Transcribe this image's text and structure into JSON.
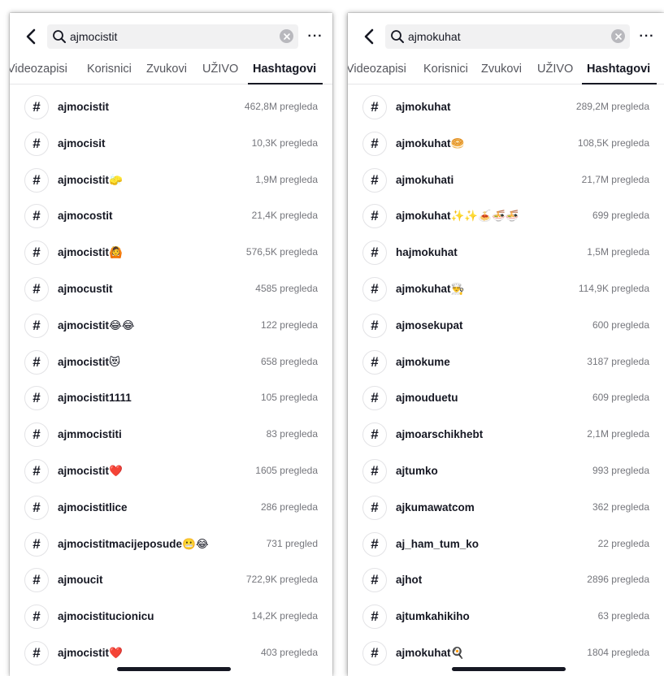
{
  "screens": [
    {
      "query": "ajmocistit",
      "tabs": [
        "Videozapisi",
        "Korisnici",
        "Zvukovi",
        "UŽIVO",
        "Hashtagovi"
      ],
      "active_tab": 4,
      "results": [
        {
          "tag": "ajmocistit",
          "views": "462,8M pregleda"
        },
        {
          "tag": "ajmocisit",
          "views": "10,3K pregleda"
        },
        {
          "tag": "ajmocistit🧽",
          "views": "1,9M pregleda"
        },
        {
          "tag": "ajmocostit",
          "views": "21,4K pregleda"
        },
        {
          "tag": "ajmocistit🙆",
          "views": "576,5K pregleda"
        },
        {
          "tag": "ajmocustit",
          "views": "4585 pregleda"
        },
        {
          "tag": "ajmocistit😂😂",
          "views": "122 pregleda"
        },
        {
          "tag": "ajmocistit😻",
          "views": "658 pregleda"
        },
        {
          "tag": "ajmocistit1111",
          "views": "105 pregleda"
        },
        {
          "tag": "ajmmocistiti",
          "views": "83 pregleda"
        },
        {
          "tag": "ajmocistit❤️",
          "views": "1605 pregleda"
        },
        {
          "tag": "ajmocistitlice",
          "views": "286 pregleda"
        },
        {
          "tag": "ajmocistitmacijeposude😬😂",
          "views": "731 pregled"
        },
        {
          "tag": "ajmoucit",
          "views": "722,9K pregleda"
        },
        {
          "tag": "ajmocistitucionicu",
          "views": "14,2K pregleda"
        },
        {
          "tag": "ajmocistit❤️",
          "views": "403 pregleda"
        }
      ]
    },
    {
      "query": "ajmokuhat",
      "tabs": [
        "Videozapisi",
        "Korisnici",
        "Zvukovi",
        "UŽIVO",
        "Hashtagovi"
      ],
      "active_tab": 4,
      "results": [
        {
          "tag": "ajmokuhat",
          "views": "289,2M pregleda"
        },
        {
          "tag": "ajmokuhat🥯",
          "views": "108,5K pregleda"
        },
        {
          "tag": "ajmokuhati",
          "views": "21,7M pregleda"
        },
        {
          "tag": "ajmokuhat✨✨🍝🍜🍜",
          "views": "699 pregleda"
        },
        {
          "tag": "hajmokuhat",
          "views": "1,5M pregleda"
        },
        {
          "tag": "ajmokuhat👨‍🍳",
          "views": "114,9K pregleda"
        },
        {
          "tag": "ajmosekupat",
          "views": "600 pregleda"
        },
        {
          "tag": "ajmokume",
          "views": "3187 pregleda"
        },
        {
          "tag": "ajmouduetu",
          "views": "609 pregleda"
        },
        {
          "tag": "ajmoarschikhebt",
          "views": "2,1M pregleda"
        },
        {
          "tag": "ajtumko",
          "views": "993 pregleda"
        },
        {
          "tag": "ajkumawatcom",
          "views": "362 pregleda"
        },
        {
          "tag": "aj_ham_tum_ko",
          "views": "22 pregleda"
        },
        {
          "tag": "ajhot",
          "views": "2896 pregleda"
        },
        {
          "tag": "ajtumkahikiho",
          "views": "63 pregleda"
        },
        {
          "tag": "ajmokuhat🍳",
          "views": "1804 pregleda"
        }
      ]
    }
  ],
  "icons": {
    "back": "chevron-left-icon",
    "search": "search-icon",
    "clear": "clear-circle-icon",
    "more": "more-horizontal-icon",
    "hashtag": "hashtag-icon"
  },
  "hash_symbol": "#",
  "more_symbol": "···",
  "colors": {
    "text_primary": "#161823",
    "text_secondary": "#75767c",
    "search_bg": "#f1f1f2",
    "divider": "#e6e6e8"
  }
}
